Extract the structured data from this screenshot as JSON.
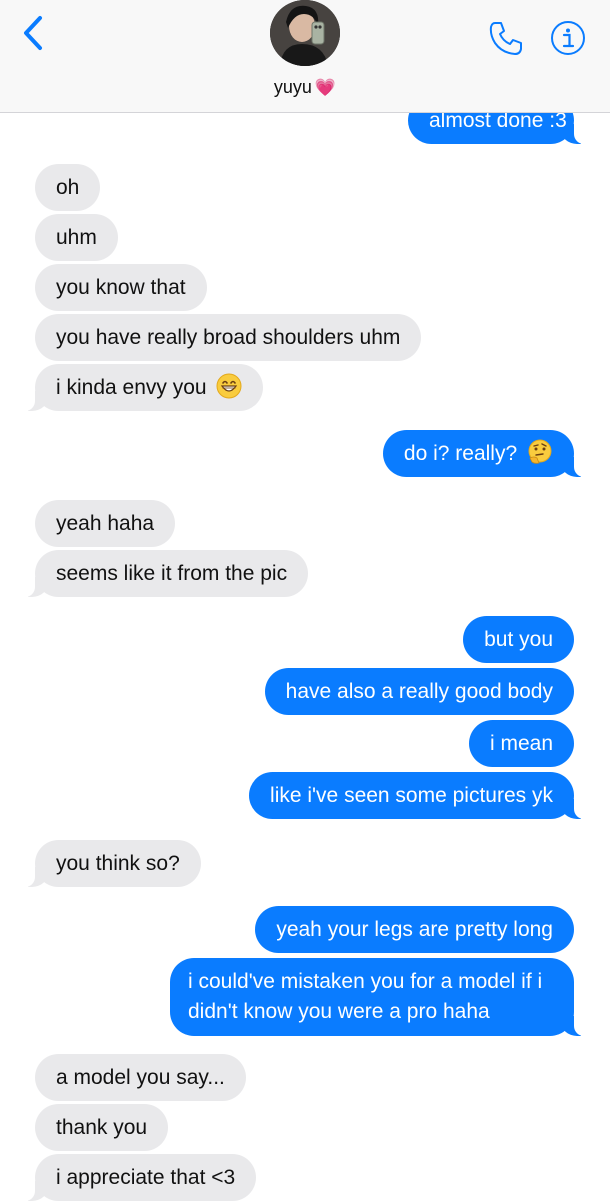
{
  "header": {
    "contact_name": "yuyu",
    "contact_emoji": "💗",
    "accent_color": "#0a7cff"
  },
  "messages": [
    {
      "dir": "out",
      "text": "almost done :3"
    },
    {
      "dir": "in",
      "text": "oh"
    },
    {
      "dir": "in",
      "text": "uhm"
    },
    {
      "dir": "in",
      "text": "you know that"
    },
    {
      "dir": "in",
      "text": "you have really broad shoulders uhm"
    },
    {
      "dir": "in",
      "text": "i kinda envy you",
      "emoji": "grinning-face"
    },
    {
      "dir": "out",
      "text": "do i? really?",
      "emoji": "thinking-face"
    },
    {
      "dir": "in",
      "text": "yeah haha"
    },
    {
      "dir": "in",
      "text": "seems like it from the pic"
    },
    {
      "dir": "out",
      "text": "but you"
    },
    {
      "dir": "out",
      "text": "have also a really good body"
    },
    {
      "dir": "out",
      "text": "i mean"
    },
    {
      "dir": "out",
      "text": "like i've seen some pictures yk"
    },
    {
      "dir": "in",
      "text": "you think so?"
    },
    {
      "dir": "out",
      "text": "yeah your legs are pretty long"
    },
    {
      "dir": "out",
      "text": "i could've mistaken you for a model if i didn't know you were a pro haha"
    },
    {
      "dir": "in",
      "text": "a model you say..."
    },
    {
      "dir": "in",
      "text": "thank you"
    },
    {
      "dir": "in",
      "text": "i appreciate that <3"
    }
  ]
}
